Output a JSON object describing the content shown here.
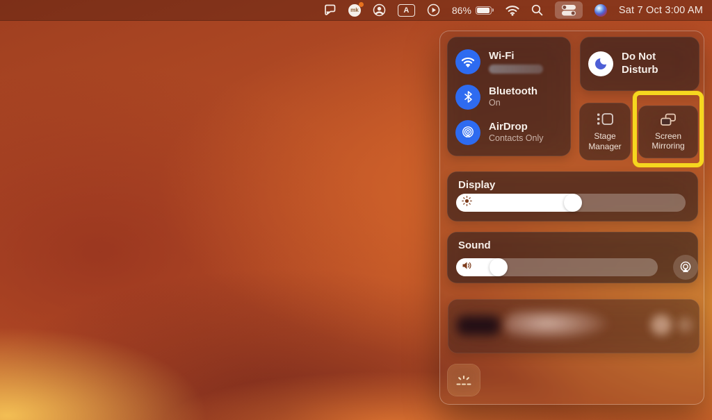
{
  "menu_bar": {
    "icons": [
      "zight-icon",
      "mk-app-icon",
      "mk-app-badge",
      "user-account-icon",
      "input-source-icon",
      "playback-icon",
      "battery-icon",
      "wifi-icon",
      "search-icon",
      "control-center-icon",
      "siri-icon"
    ],
    "battery_percent": "86%",
    "input_source_letter": "A",
    "mk_initials": "mk",
    "clock": "Sat 7 Oct  3:00 AM"
  },
  "control_center": {
    "wifi": {
      "label": "Wi-Fi",
      "icon": "wifi-icon",
      "network_name_redacted": true
    },
    "bluetooth": {
      "label": "Bluetooth",
      "status": "On",
      "icon": "bluetooth-icon"
    },
    "airdrop": {
      "label": "AirDrop",
      "status": "Contacts Only",
      "icon": "airdrop-icon"
    },
    "do_not_disturb": {
      "label": "Do Not Disturb",
      "icon": "moon-icon"
    },
    "stage_manager": {
      "label": "Stage Manager",
      "icon": "stage-manager-icon"
    },
    "screen_mirroring": {
      "label": "Screen Mirroring",
      "icon": "screen-mirroring-icon",
      "highlighted": true
    },
    "display": {
      "label": "Display",
      "brightness_percent": 51,
      "icon": "brightness-sun-icon"
    },
    "sound": {
      "label": "Sound",
      "volume_percent": 21,
      "icon": "speaker-icon",
      "airplay_icon": "airplay-audio-icon"
    },
    "media_player": {
      "content_redacted": true
    },
    "keyboard_brightness": {
      "icon": "keyboard-brightness-icon"
    }
  },
  "colors": {
    "accent_blue": "#2E6BF0",
    "highlight_yellow": "#F6D71F",
    "dnd_moon_blue": "#4D5FD6",
    "menu_bar_text": "#F4EBE5"
  }
}
